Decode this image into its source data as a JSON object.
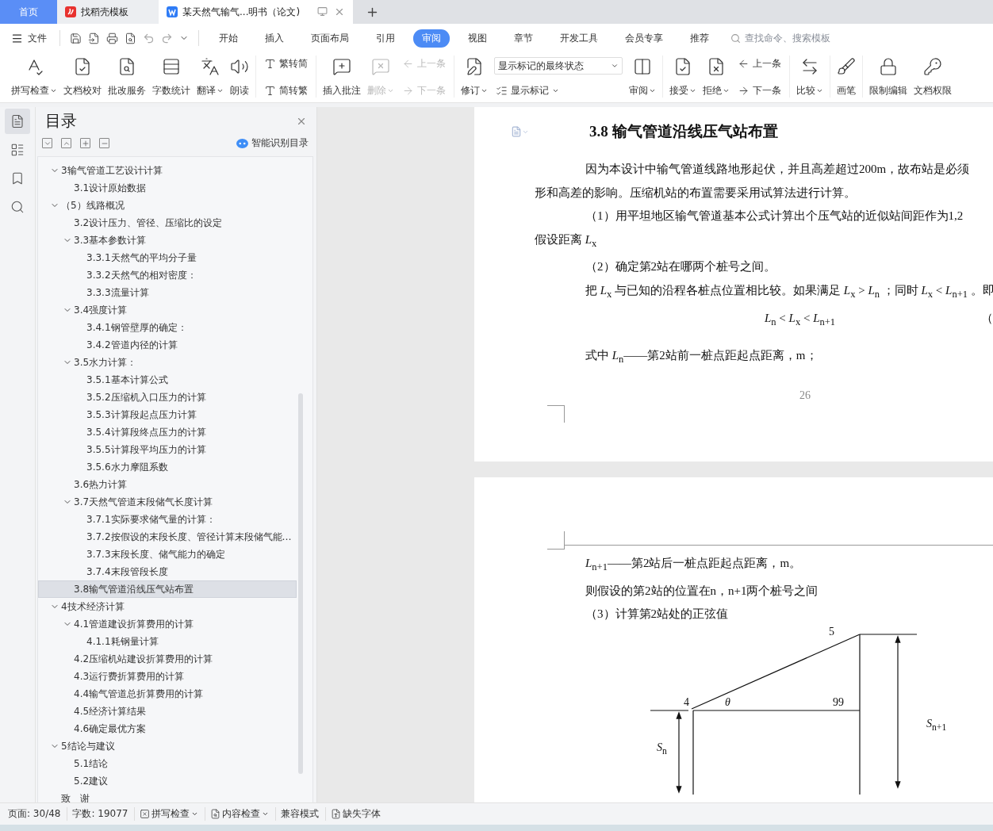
{
  "tabs": [
    {
      "label": "首页",
      "kind": "home",
      "selected": false
    },
    {
      "label": "找稻壳模板",
      "kind": "docer",
      "selected": false
    },
    {
      "label": "某天然气输气...明书（论文)",
      "kind": "doc",
      "selected": true
    }
  ],
  "menu": {
    "file": "文件",
    "tabs": [
      {
        "label": "开始",
        "selected": false
      },
      {
        "label": "插入",
        "selected": false
      },
      {
        "label": "页面布局",
        "selected": false
      },
      {
        "label": "引用",
        "selected": false
      },
      {
        "label": "审阅",
        "selected": true
      },
      {
        "label": "视图",
        "selected": false
      },
      {
        "label": "章节",
        "selected": false
      },
      {
        "label": "开发工具",
        "selected": false
      },
      {
        "label": "会员专享",
        "selected": false
      },
      {
        "label": "推荐",
        "selected": false
      }
    ],
    "search": {
      "placeholder": "查找命令、搜索模板"
    }
  },
  "ribbon": [
    {
      "items": [
        {
          "kind": "large",
          "label": "拼写检查",
          "dropdown": true,
          "disabled": false
        },
        {
          "kind": "large",
          "label": "文档校对",
          "dropdown": false,
          "disabled": false
        },
        {
          "kind": "large",
          "label": "批改服务",
          "dropdown": false,
          "disabled": false
        },
        {
          "kind": "large",
          "label": "字数统计",
          "dropdown": false,
          "disabled": false
        },
        {
          "kind": "large",
          "label": "翻译",
          "dropdown": true,
          "disabled": false
        },
        {
          "kind": "large",
          "label": "朗读",
          "dropdown": false,
          "disabled": false
        }
      ]
    },
    {
      "items": [
        {
          "kind": "stack",
          "items": [
            {
              "kind": "small",
              "label": "繁转简",
              "dropdown": false,
              "disabled": false
            },
            {
              "kind": "small",
              "label": "简转繁",
              "dropdown": false,
              "disabled": false
            }
          ]
        }
      ]
    },
    {
      "items": [
        {
          "kind": "large",
          "label": "插入批注",
          "dropdown": false,
          "disabled": false
        },
        {
          "kind": "large",
          "label": "删除",
          "dropdown": true,
          "disabled": true
        },
        {
          "kind": "stack",
          "items": [
            {
              "kind": "small",
              "label": "上一条",
              "dropdown": false,
              "disabled": true
            },
            {
              "kind": "small",
              "label": "下一条",
              "dropdown": false,
              "disabled": true
            }
          ]
        }
      ]
    },
    {
      "items": [
        {
          "kind": "large",
          "label": "修订",
          "dropdown": true,
          "disabled": false
        },
        {
          "kind": "stack",
          "items": [
            {
              "kind": "select",
              "value": "显示标记的最终状态"
            },
            {
              "kind": "small",
              "label": "显示标记",
              "dropdown": true,
              "disabled": false
            }
          ]
        },
        {
          "kind": "large",
          "label": "审阅",
          "dropdown": true,
          "disabled": false
        }
      ]
    },
    {
      "items": [
        {
          "kind": "large",
          "label": "接受",
          "dropdown": true,
          "disabled": false
        },
        {
          "kind": "large",
          "label": "拒绝",
          "dropdown": true,
          "disabled": false
        },
        {
          "kind": "stack",
          "items": [
            {
              "kind": "small",
              "label": "上一条",
              "dropdown": false,
              "disabled": false
            },
            {
              "kind": "small",
              "label": "下一条",
              "dropdown": false,
              "disabled": false
            }
          ]
        }
      ]
    },
    {
      "items": [
        {
          "kind": "large",
          "label": "比较",
          "dropdown": true,
          "disabled": false
        }
      ]
    },
    {
      "items": [
        {
          "kind": "large",
          "label": "画笔",
          "dropdown": false,
          "disabled": false
        }
      ]
    },
    {
      "items": [
        {
          "kind": "large",
          "label": "限制编辑",
          "dropdown": false,
          "disabled": false
        },
        {
          "kind": "large",
          "label": "文档权限",
          "dropdown": false,
          "disabled": false
        }
      ]
    }
  ],
  "side_rail": [
    {
      "selected": true
    },
    {
      "selected": false
    },
    {
      "selected": false
    },
    {
      "selected": false
    }
  ],
  "toc": {
    "title": "目录",
    "smart_link": "智能识别目录",
    "items": [
      {
        "label": "3输气管道工艺设计计算",
        "selected": false,
        "expanded": true,
        "children": [
          {
            "label": "3.1设计原始数据",
            "selected": false
          }
        ]
      },
      {
        "label": "（5）线路概况",
        "selected": false,
        "expanded": true,
        "children": [
          {
            "label": "3.2设计压力、管径、压缩比的设定",
            "selected": false
          },
          {
            "label": "3.3基本参数计算",
            "selected": false,
            "expanded": true,
            "children": [
              {
                "label": "3.3.1天然气的平均分子量",
                "selected": false
              },
              {
                "label": "3.3.2天然气的相对密度：",
                "selected": false
              },
              {
                "label": "3.3.3流量计算",
                "selected": false
              }
            ]
          },
          {
            "label": "3.4强度计算",
            "selected": false,
            "expanded": true,
            "children": [
              {
                "label": "3.4.1钢管壁厚的确定：",
                "selected": false
              },
              {
                "label": "3.4.2管道内径的计算",
                "selected": false
              }
            ]
          },
          {
            "label": "3.5水力计算：",
            "selected": false,
            "expanded": true,
            "children": [
              {
                "label": "3.5.1基本计算公式",
                "selected": false
              },
              {
                "label": "3.5.2压缩机入口压力的计算",
                "selected": false
              },
              {
                "label": "3.5.3计算段起点压力计算",
                "selected": false
              },
              {
                "label": "3.5.4计算段终点压力的计算",
                "selected": false
              },
              {
                "label": "3.5.5计算段平均压力的计算",
                "selected": false
              },
              {
                "label": "3.5.6水力摩阻系数",
                "selected": false
              }
            ]
          },
          {
            "label": "3.6热力计算",
            "selected": false
          },
          {
            "label": "3.7天然气管道末段储气长度计算",
            "selected": false,
            "expanded": true,
            "children": [
              {
                "label": "3.7.1实际要求储气量的计算：",
                "selected": false
              },
              {
                "label": "3.7.2按假设的末段长度、管径计算末段储气能…",
                "selected": false
              },
              {
                "label": "3.7.3末段长度、储气能力的确定",
                "selected": false
              },
              {
                "label": "3.7.4末段管段长度",
                "selected": false
              }
            ]
          },
          {
            "label": "3.8输气管道沿线压气站布置",
            "selected": true
          }
        ]
      },
      {
        "label": "4技术经济计算",
        "selected": false,
        "expanded": true,
        "children": [
          {
            "label": "4.1管道建设折算费用的计算",
            "selected": false,
            "expanded": true,
            "children": [
              {
                "label": "4.1.1耗钢量计算",
                "selected": false
              }
            ]
          },
          {
            "label": "4.2压缩机站建设折算费用的计算",
            "selected": false
          },
          {
            "label": "4.3运行费折算费用的计算",
            "selected": false
          },
          {
            "label": "4.4输气管道总折算费用的计算",
            "selected": false
          },
          {
            "label": "4.5经济计算结果",
            "selected": false
          },
          {
            "label": "4.6确定最优方案",
            "selected": false
          }
        ]
      },
      {
        "label": "5结论与建议",
        "selected": false,
        "expanded": true,
        "children": [
          {
            "label": "5.1结论",
            "selected": false
          },
          {
            "label": "5.2建议",
            "selected": false
          }
        ]
      },
      {
        "label": "致　谢",
        "selected": false
      }
    ]
  },
  "document": {
    "pages": [
      {
        "heading": "3.8  输气管道沿线压气站布置",
        "lines": [
          {
            "kind": "first",
            "text": "因为本设计中输气管道线路地形起伏，并且高差超过200m，故布站是必须"
          },
          {
            "kind": "body",
            "text": "形和高差的影响。压缩机站的布置需要采用试算法进行计算。"
          },
          {
            "kind": "first",
            "text": "（1）用平坦地区输气管道基本公式计算出个压气站的近似站间距作为1,2"
          },
          {
            "kind": "body",
            "text": "假设距离 *L*$_{x}$"
          },
          {
            "kind": "first",
            "text": "（2）确定第2站在哪两个桩号之间。"
          },
          {
            "kind": "first",
            "text": "把 *L*$_{x}$ 与已知的沿程各桩点位置相比较。如果满足 *L*$_{x}$ > *L*$_{n}$ ；同时 *L*$_{x}$ < *L*$_{n+1}$ 。即"
          },
          {
            "kind": "formula",
            "text": "*L*$_{n}$ < *L*$_{x}$ < *L*$_{n+1}$",
            "number": "（"
          },
          {
            "kind": "first",
            "text": "式中 *L*$_{n}$——第2站前一桩点距起点距离，m；"
          }
        ],
        "page_number": "26"
      },
      {
        "lines": [
          {
            "kind": "first",
            "text": "*L*$_{n+1}$——第2站后一桩点距起点距离，m。"
          },
          {
            "kind": "first",
            "text": "则假设的第2站的位置在n，n+1两个桩号之间"
          },
          {
            "kind": "first",
            "text": "（3）计算第2站处的正弦值"
          }
        ],
        "diagram": {
          "top_point": "5",
          "left_point": "4",
          "angle": "θ",
          "right_point": "99",
          "left_height": "*S*$_{n}$",
          "right_height": "*S*$_{n+1}$"
        }
      }
    ]
  },
  "status_bar": [
    {
      "kind": "text",
      "label": "页面: 30/48"
    },
    {
      "kind": "text",
      "label": "字数: 19077"
    },
    {
      "kind": "check_menu",
      "label": "拼写检查"
    },
    {
      "kind": "check_menu",
      "label": "内容检查"
    },
    {
      "kind": "text",
      "label": "兼容模式"
    },
    {
      "kind": "font_button",
      "label": "缺失字体"
    }
  ]
}
